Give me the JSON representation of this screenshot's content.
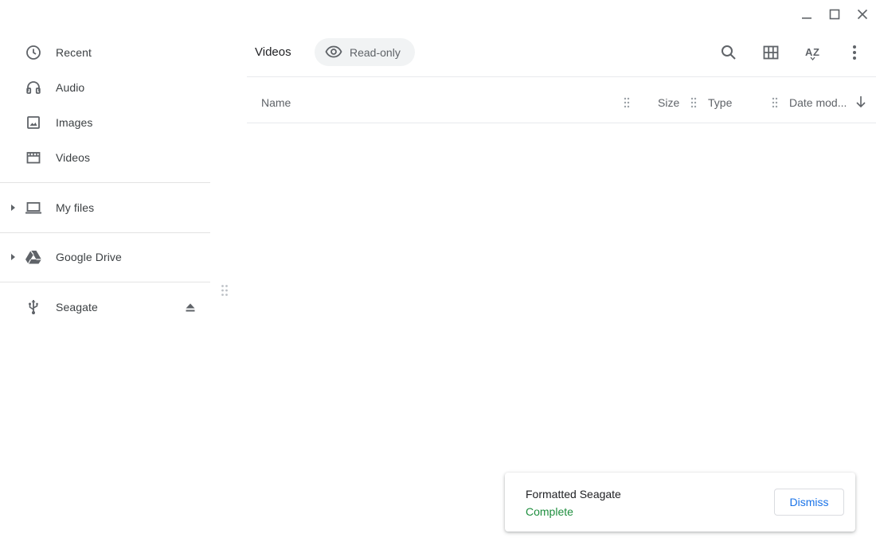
{
  "window": {
    "controls": [
      "minimize",
      "maximize",
      "close"
    ]
  },
  "sidebar": {
    "items": [
      {
        "label": "Recent",
        "icon": "clock-icon"
      },
      {
        "label": "Audio",
        "icon": "headphones-icon"
      },
      {
        "label": "Images",
        "icon": "image-icon"
      },
      {
        "label": "Videos",
        "icon": "film-icon"
      },
      {
        "label": "My files",
        "icon": "laptop-icon",
        "expandable": true
      },
      {
        "label": "Google Drive",
        "icon": "drive-icon",
        "expandable": true
      },
      {
        "label": "Seagate",
        "icon": "usb-icon",
        "ejectable": true
      }
    ]
  },
  "header": {
    "breadcrumb": "Videos",
    "readonly_label": "Read-only",
    "tools": [
      "search-icon",
      "grid-view-icon",
      "sort-az-icon",
      "more-vert-icon"
    ]
  },
  "table": {
    "columns": [
      "Name",
      "Size",
      "Type",
      "Date mod..."
    ],
    "sort_direction": "descending"
  },
  "notification": {
    "title": "Formatted Seagate",
    "status": "Complete",
    "dismiss_label": "Dismiss",
    "status_color": "#1e8e3e",
    "action_color": "#1a73e8"
  }
}
